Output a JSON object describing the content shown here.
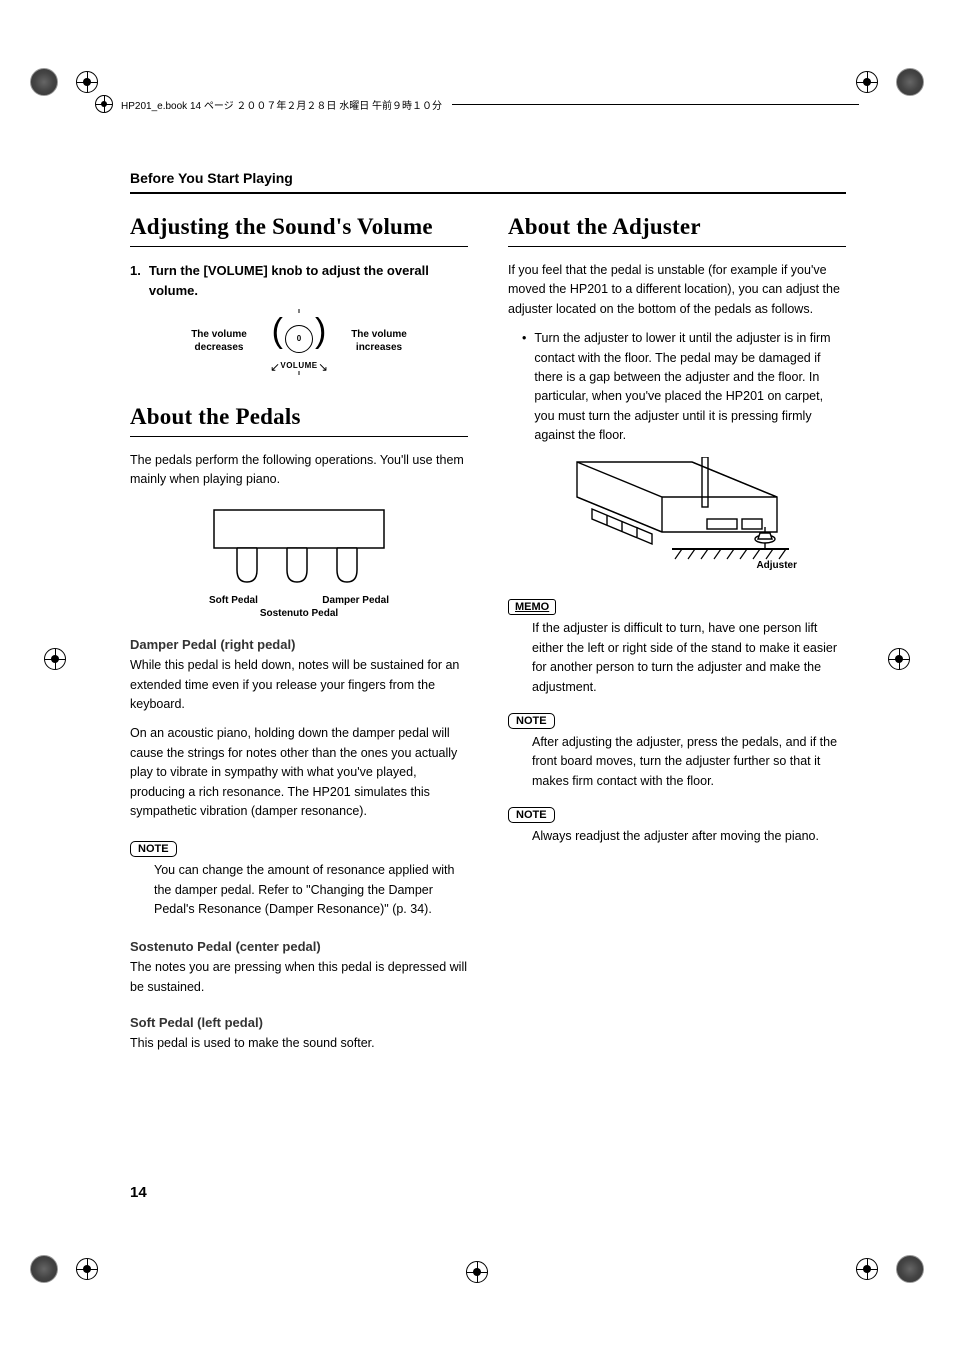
{
  "meta": {
    "print_header": "HP201_e.book 14 ページ ２００７年２月２８日 水曜日 午前９時１０分"
  },
  "running_head": "Before You Start Playing",
  "page_number": "14",
  "left": {
    "h_volume": "Adjusting the Sound's Volume",
    "step1_num": "1.",
    "step1_text": "Turn the [VOLUME] knob to adjust the overall volume.",
    "vol_dec_l1": "The volume",
    "vol_dec_l2": "decreases",
    "vol_inc_l1": "The volume",
    "vol_inc_l2": "increases",
    "vol_knob_mark": "0",
    "vol_label": "VOLUME",
    "h_pedals": "About the Pedals",
    "pedals_intro": "The pedals perform the following operations. You'll use them mainly when playing piano.",
    "pedal_soft": "Soft Pedal",
    "pedal_damper": "Damper Pedal",
    "pedal_sostenuto": "Sostenuto Pedal",
    "damper_h": "Damper Pedal (right pedal)",
    "damper_p1": "While this pedal is held down, notes will be sustained for an extended time even if you release your fingers from the keyboard.",
    "damper_p2": "On an acoustic piano, holding down the damper pedal will cause the strings for notes other than the ones you actually play to vibrate in sympathy with what you've played, producing a rich resonance. The HP201 simulates this sympathetic vibration (damper resonance).",
    "note_label": "NOTE",
    "damper_note": "You can change the amount of resonance applied with the damper pedal. Refer to \"Changing the Damper Pedal's Resonance (Damper Resonance)\" (p. 34).",
    "sostenuto_h": "Sostenuto Pedal (center pedal)",
    "sostenuto_p": "The notes you are pressing when this pedal is depressed will be sustained.",
    "soft_h": "Soft Pedal (left pedal)",
    "soft_p": "This pedal is used to make the sound softer."
  },
  "right": {
    "h_adjuster": "About the Adjuster",
    "adj_intro": "If you feel that the pedal is unstable (for example if you've moved the HP201 to a different location), you can adjust the adjuster located on the bottom of the pedals as follows.",
    "adj_bullet": "Turn the adjuster to lower it until the adjuster is in firm contact with the floor. The pedal may be damaged if there is a gap between the adjuster and the floor. In particular, when you've placed the HP201 on carpet, you must turn the adjuster until it is pressing firmly against the floor.",
    "adj_caption": "Adjuster",
    "memo_label": "MEMO",
    "memo_body": "If the adjuster is difficult to turn, have one person lift either the left or right side of the stand to make it easier for another person to turn the adjuster and make the adjustment.",
    "note_label": "NOTE",
    "note1_body": "After adjusting the adjuster, press the pedals, and if the front board moves, turn the adjuster further so that it makes firm contact with the floor.",
    "note2_body": "Always readjust the adjuster after moving the piano."
  }
}
